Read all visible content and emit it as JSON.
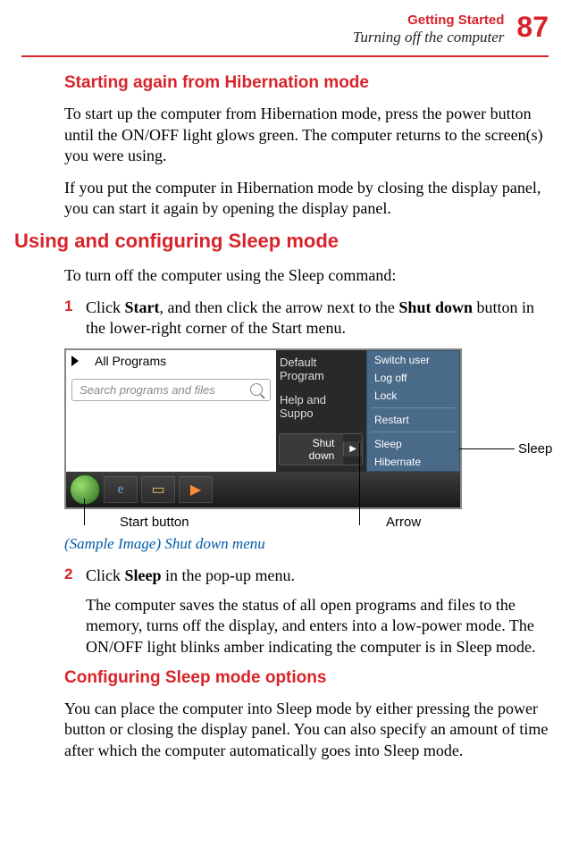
{
  "header": {
    "chapter": "Getting Started",
    "subtitle": "Turning off the computer",
    "pageNumber": "87"
  },
  "sections": {
    "h1": "Starting again from Hibernation mode",
    "p1": "To start up the computer from Hibernation mode, press the power button until the ON/OFF light glows green. The computer returns to the screen(s) you were using.",
    "p2": "If you put the computer in Hibernation mode by closing the display panel, you can start it again by opening the display panel.",
    "h2": "Using and configuring Sleep mode",
    "p3": "To turn off the computer using the Sleep command:",
    "step1_num": "1",
    "step1_a": "Click ",
    "step1_b": "Start",
    "step1_c": ", and then click the arrow next to the ",
    "step1_d": "Shut down",
    "step1_e": " button in the lower-right corner of the Start menu.",
    "step2_num": "2",
    "step2_a": "Click ",
    "step2_b": "Sleep",
    "step2_c": " in the pop-up menu.",
    "p4": "The computer saves the status of all open programs and files to the memory, turns off the display, and enters into a low-power mode. The ON/OFF light blinks amber indicating the computer is in Sleep mode.",
    "h3": "Configuring Sleep mode options",
    "p5": "You can place the computer into Sleep mode by either pressing the power button or closing the display panel. You can also specify an amount of time after which the computer automatically goes into Sleep mode."
  },
  "figure": {
    "allPrograms": "All Programs",
    "searchPlaceholder": "Search programs and files",
    "darkLinks": [
      "Default Program",
      "Help and Suppo"
    ],
    "shutdown": "Shut down",
    "panel": {
      "switchUser": "Switch user",
      "logOff": "Log off",
      "lock": "Lock",
      "restart": "Restart",
      "sleep": "Sleep",
      "hibernate": "Hibernate"
    },
    "callouts": {
      "startButton": "Start button",
      "arrow": "Arrow",
      "sleep": "Sleep"
    },
    "caption": "(Sample Image) Shut down menu"
  }
}
